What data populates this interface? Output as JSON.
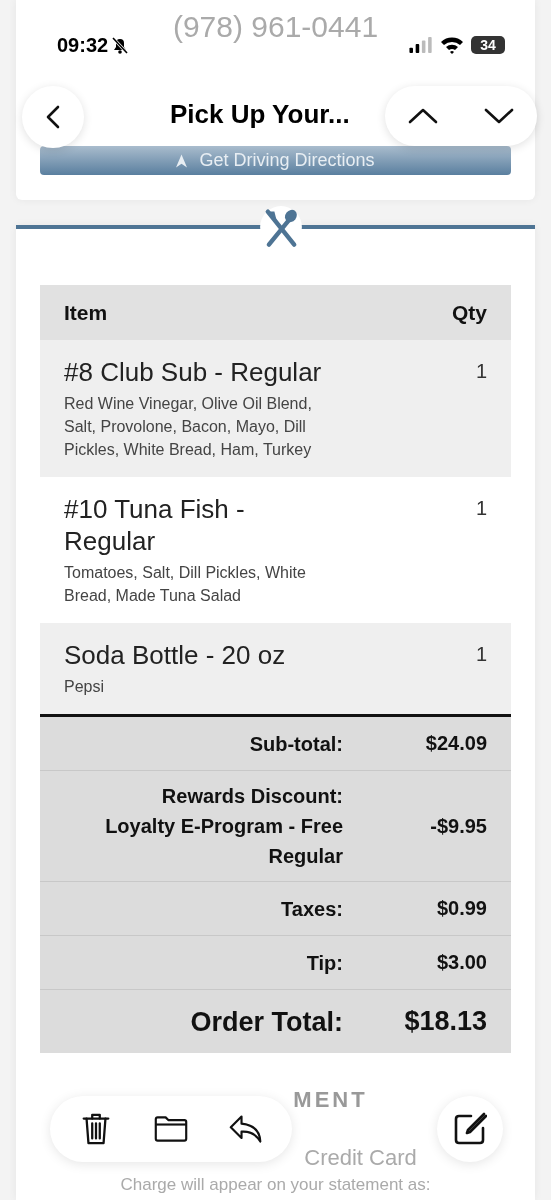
{
  "status_bar": {
    "time": "09:32",
    "battery": "34"
  },
  "nav": {
    "title": "Pick Up Your..."
  },
  "store": {
    "phone": "(978) 961-0441",
    "directions": "Get Driving Directions"
  },
  "table": {
    "columns": [
      "Item",
      "Qty"
    ],
    "rows": [
      {
        "name": "#8 Club Sub - Regular",
        "details": "Red Wine Vinegar, Olive Oil Blend, Salt, Provolone, Bacon, Mayo, Dill Pickles, White Bread, Ham, Turkey",
        "qty": "1"
      },
      {
        "name": "#10 Tuna Fish - Regular",
        "details": "Tomatoes, Salt, Dill Pickles, White Bread, Made Tuna Salad",
        "qty": "1"
      },
      {
        "name": "Soda Bottle - 20 oz",
        "details": "Pepsi",
        "qty": "1"
      }
    ],
    "totals": [
      {
        "label": "Sub-total:",
        "value": "$24.09",
        "kind": "normal"
      },
      {
        "label": "Rewards Discount: Loyalty E-Program - Free Regular",
        "value": "-$9.95",
        "kind": "normal"
      },
      {
        "label": "Taxes:",
        "value": "$0.99",
        "kind": "normal"
      },
      {
        "label": "Tip:",
        "value": "$3.00",
        "kind": "normal"
      },
      {
        "label": "Order Total:",
        "value": "$18.13",
        "kind": "grand"
      }
    ]
  },
  "payment": {
    "heading": "MENT",
    "method": "Credit Card",
    "note": "Charge will appear on your statement as:"
  }
}
